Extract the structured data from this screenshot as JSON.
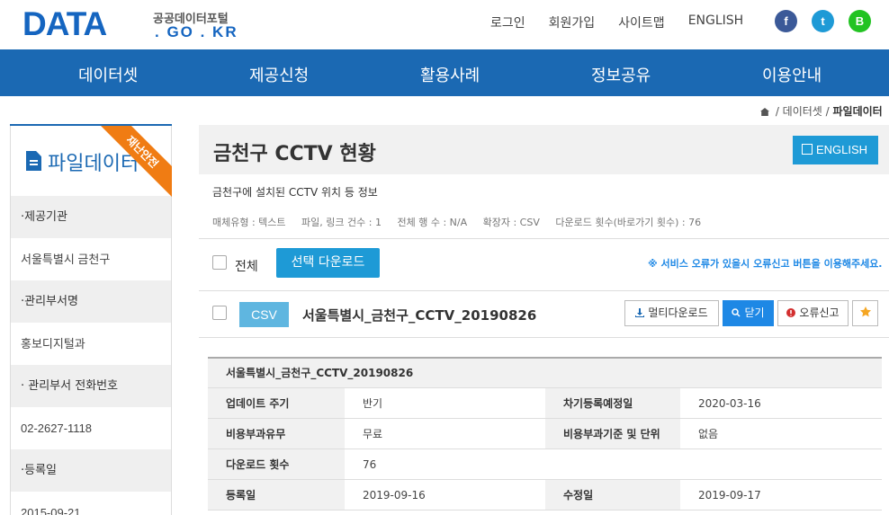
{
  "logo": {
    "main": "DATA",
    "sub_kr": "공공데이터포털",
    "sub_en": ". GO . KR"
  },
  "top_links": [
    "로그인",
    "회원가입",
    "사이트맵",
    "ENGLISH"
  ],
  "social": [
    {
      "name": "facebook",
      "glyph": "f",
      "color": "#3b5998"
    },
    {
      "name": "twitter",
      "glyph": "t",
      "color": "#1e9ad6"
    },
    {
      "name": "blog",
      "glyph": "B",
      "color": "#22c322"
    }
  ],
  "nav": [
    "데이터셋",
    "제공신청",
    "활용사례",
    "정보공유",
    "이용안내"
  ],
  "breadcrumb": {
    "items": [
      "데이터셋",
      "파일데이터"
    ]
  },
  "sidebar": {
    "title": "파일데이터",
    "ribbon": "재난안전",
    "rows": [
      {
        "label": "·제공기관",
        "value": "서울특별시 금천구"
      },
      {
        "label": "·관리부서명",
        "value": "홍보디지털과"
      },
      {
        "label": "· 관리부서 전화번호",
        "value": "02-2627-1118"
      },
      {
        "label": "·등록일",
        "value": "2015-09-21"
      }
    ]
  },
  "main": {
    "title": "금천구 CCTV 현황",
    "english_button": "ENGLISH",
    "description": "금천구에 설치된 CCTV 위치 등 정보",
    "meta": [
      "매체유형 : 텍스트",
      "파일, 링크 건수 : 1",
      "전체 행 수 : N/A",
      "확장자 : CSV",
      "다운로드 횟수(바로가기 횟수) : 76"
    ],
    "select_all_label": "전체",
    "select_download": "선택 다운로드",
    "notice": "※ 서비스 오류가 있을시 오류신고 버튼을 이용해주세요.",
    "file": {
      "format": "CSV",
      "name": "서울특별시_금천구_CCTV_20190826",
      "buttons": {
        "multi_download": "멀티다운로드",
        "close": "닫기",
        "report": "오류신고"
      }
    },
    "detail": {
      "title": "서울특별시_금천구_CCTV_20190826",
      "rows": [
        {
          "k1": "업데이트 주기",
          "v1": "반기",
          "k2": "차기등록예정일",
          "v2": "2020-03-16"
        },
        {
          "k1": "비용부과유무",
          "v1": "무료",
          "k2": "비용부과기준 및 단위",
          "v2": "없음"
        },
        {
          "k1": "다운로드 횟수",
          "v1": "76"
        },
        {
          "k1": "등록일",
          "v1": "2019-09-16",
          "k2": "수정일",
          "v2": "2019-09-17"
        }
      ]
    }
  }
}
